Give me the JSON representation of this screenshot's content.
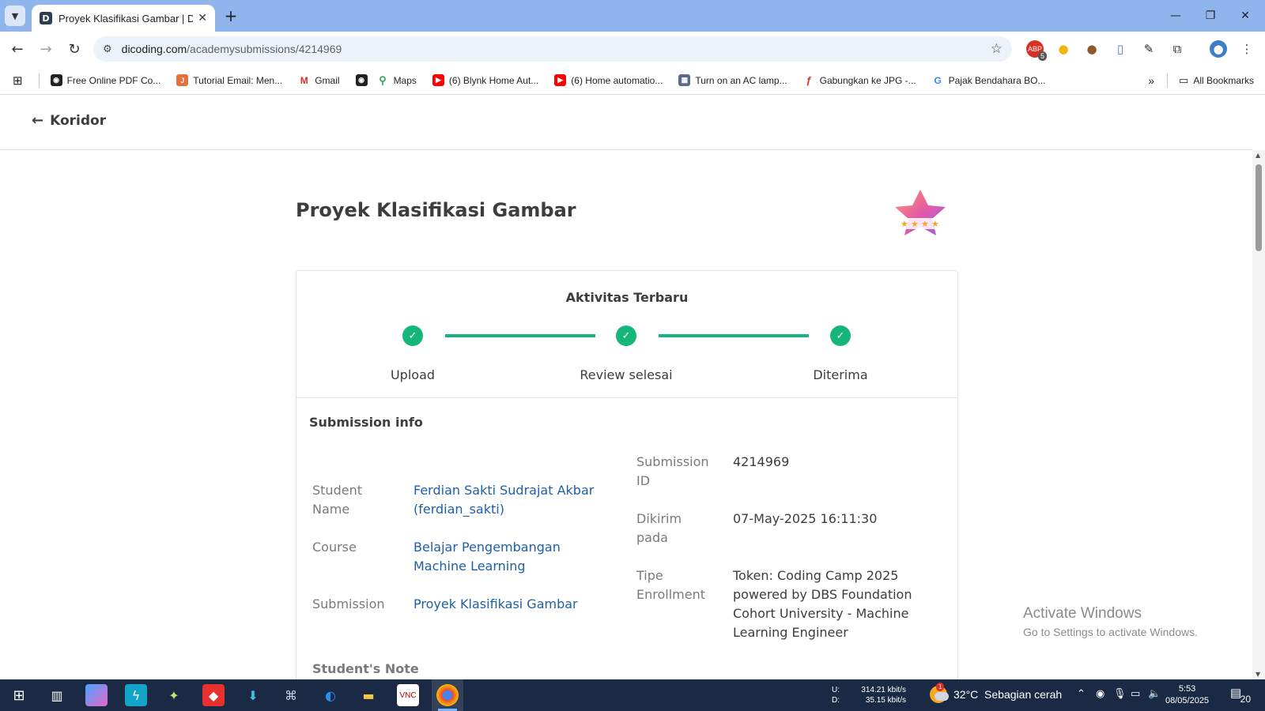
{
  "browser": {
    "tab_title": "Proyek Klasifikasi Gambar | Dicoding",
    "tab_favicon": "dicoding-icon",
    "url_host": "dicoding.com",
    "url_path": "/academysubmissions/4214969",
    "extension_badge": "5",
    "bookmarks": [
      {
        "label": "Free Online PDF Co...",
        "icon": "globe-icon"
      },
      {
        "label": "Tutorial Email: Men...",
        "icon": "site-icon"
      },
      {
        "label": "Gmail",
        "icon": "gmail-icon"
      },
      {
        "label": "",
        "icon": "globe-icon"
      },
      {
        "label": "Maps",
        "icon": "maps-icon"
      },
      {
        "label": "(6) Blynk Home Aut...",
        "icon": "youtube-icon"
      },
      {
        "label": "(6) Home automatio...",
        "icon": "youtube-icon"
      },
      {
        "label": "Turn on an AC lamp...",
        "icon": "site-icon"
      },
      {
        "label": "Gabungkan ke JPG -...",
        "icon": "site-icon"
      },
      {
        "label": "Pajak Bendahara BO...",
        "icon": "google-icon"
      }
    ],
    "all_bookmarks": "All Bookmarks"
  },
  "page": {
    "back_label": "Koridor",
    "title": "Proyek Klasifikasi Gambar",
    "badge_rating": 4,
    "activity": {
      "title": "Aktivitas Terbaru",
      "steps": [
        "Upload",
        "Review selesai",
        "Diterima"
      ]
    },
    "submission_info": {
      "heading": "Submission info",
      "student_name_label": "Student Name",
      "student_name_value": "Ferdian Sakti Sudrajat Akbar (ferdian_sakti)",
      "course_label": "Course",
      "course_value": "Belajar Pengembangan Machine Learning",
      "submission_label": "Submission",
      "submission_value": "Proyek Klasifikasi Gambar",
      "submission_id_label": "Submission ID",
      "submission_id_value": "4214969",
      "sent_label": "Dikirim pada",
      "sent_value": "07-May-2025 16:11:30",
      "enroll_label": "Tipe Enrollment",
      "enroll_value": "Token: Coding Camp 2025 powered by DBS Foundation Cohort University - Machine Learning Engineer",
      "note_label": "Student's Note"
    },
    "watermark": {
      "line1": "Activate Windows",
      "line2": "Go to Settings to activate Windows."
    }
  },
  "taskbar": {
    "net_up_label": "U:",
    "net_up_value": "314.21 kbit/s",
    "net_down_label": "D:",
    "net_down_value": "35.15 kbit/s",
    "weather_badge": "1",
    "weather": "32°C  Sebagian cerah",
    "time": "5:53",
    "date": "08/05/2025",
    "notifications": "20"
  },
  "colors": {
    "accent_green": "#16b67b",
    "link_blue": "#1e5fa8",
    "tabstrip": "#8fb5ec",
    "taskbar": "#1b2a44"
  }
}
